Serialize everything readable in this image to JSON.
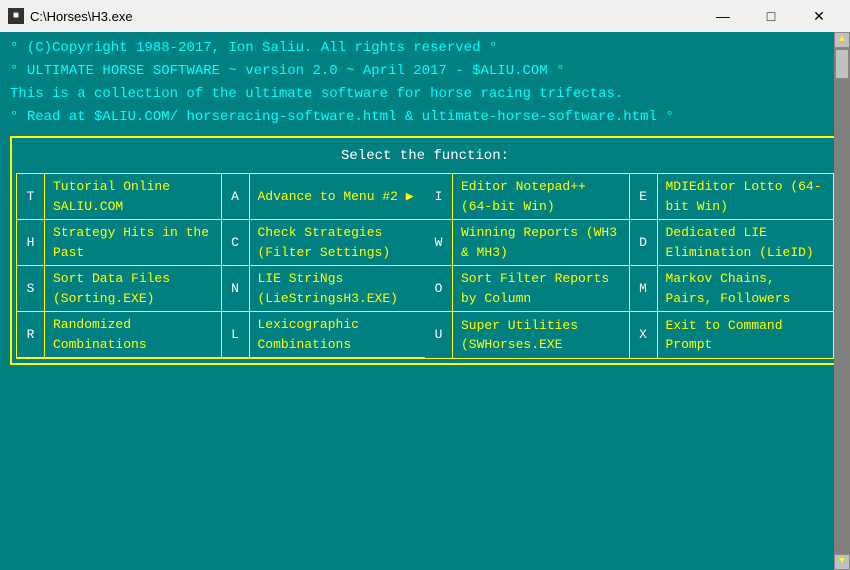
{
  "window": {
    "title": "C:\\Horses\\H3.exe",
    "icon": "■"
  },
  "controls": {
    "minimize": "—",
    "maximize": "□",
    "close": "✕"
  },
  "header": {
    "line1": "(C)Copyright 1988-2017, Ion Saliu. All rights reserved",
    "line2": "ULTIMATE HORSE SOFTWARE ~ version 2.0 ~ April 2017 - $ALIU.COM",
    "line3": "This is a collection of the ultimate software for horse racing trifectas.",
    "line4": "Read at $ALIU.COM/ horseracing-software.html & ultimate-horse-software.html"
  },
  "menu": {
    "title": "Select the function:",
    "rows": [
      {
        "left_key": "T",
        "left_label": "Tutorial Online SALIU.COM",
        "right_key": "A",
        "right_label": "Advance to Menu #2 ▶"
      },
      {
        "left_key": "I",
        "left_label": "Editor Notepad++ (64-bit Win)",
        "right_key": "E",
        "right_label": "MDIEditor Lotto (64-bit Win)"
      },
      {
        "left_key": "H",
        "left_label": "Strategy Hits in the Past",
        "right_key": "C",
        "right_label": "Check Strategies (Filter Settings)"
      },
      {
        "left_key": "W",
        "left_label": "Winning Reports (WH3 & MH3)",
        "right_key": "D",
        "right_label": "Dedicated LIE Elimination (LieID)"
      },
      {
        "left_key": "S",
        "left_label": "Sort Data Files (Sorting.EXE)",
        "right_key": "N",
        "right_label": "LIE StriNgs (LieStringsH3.EXE)"
      },
      {
        "left_key": "O",
        "left_label": "Sort Filter Reports by Column",
        "right_key": "M",
        "right_label": "Markov Chains, Pairs, Followers"
      },
      {
        "left_key": "R",
        "left_label": "Randomized Combinations",
        "right_key": "L",
        "right_label": "Lexicographic Combinations"
      },
      {
        "left_key": "U",
        "left_label": "Super Utilities (SWHorses.EXE",
        "right_key": "X",
        "right_label": "Exit to Command Prompt"
      }
    ]
  }
}
